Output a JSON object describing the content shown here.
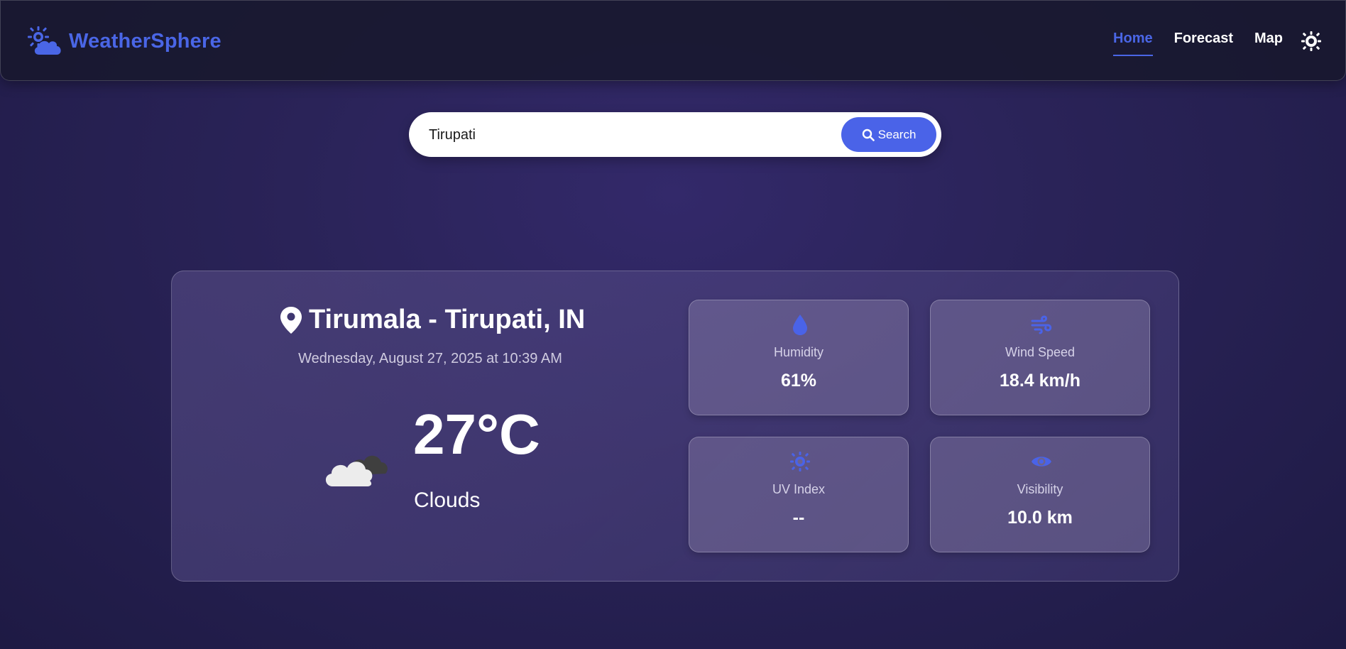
{
  "app": {
    "name": "WeatherSphere",
    "accent_color": "#4a66e6",
    "logo_icon": "sun-cloud-icon"
  },
  "nav": {
    "items": [
      {
        "label": "Home",
        "active": true
      },
      {
        "label": "Forecast",
        "active": false
      },
      {
        "label": "Map",
        "active": false
      }
    ],
    "theme_toggle_icon": "sun-icon"
  },
  "search": {
    "value": "Tirupati",
    "button_label": "Search",
    "button_icon": "search-icon"
  },
  "current": {
    "location": "Tirumala - Tirupati, IN",
    "location_icon": "map-pin-icon",
    "datetime": "Wednesday, August 27, 2025 at 10:39 AM",
    "temperature": "27°C",
    "condition": "Clouds",
    "condition_icon": "cloud-icon"
  },
  "stats": [
    {
      "label": "Humidity",
      "value": "61%",
      "icon": "droplet-icon"
    },
    {
      "label": "Wind Speed",
      "value": "18.4 km/h",
      "icon": "wind-icon"
    },
    {
      "label": "UV Index",
      "value": "--",
      "icon": "sun-icon"
    },
    {
      "label": "Visibility",
      "value": "10.0 km",
      "icon": "eye-icon"
    }
  ]
}
